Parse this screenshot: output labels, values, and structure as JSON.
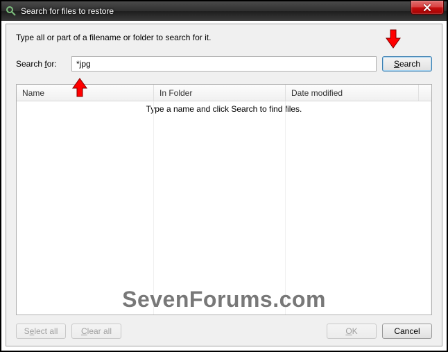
{
  "window": {
    "title": "Search for files to restore"
  },
  "instruction": "Type all or part of a filename or folder to search for it.",
  "search": {
    "label_pre": "Search ",
    "label_u": "f",
    "label_post": "or:",
    "value": "*jpg",
    "button_u": "S",
    "button_post": "earch"
  },
  "columns": {
    "name": "Name",
    "folder": "In Folder",
    "date": "Date modified"
  },
  "results": {
    "empty_message": "Type a name and click Search to find files."
  },
  "buttons": {
    "select_all_pre": "S",
    "select_all_u": "e",
    "select_all_post": "lect all",
    "clear_all_u": "C",
    "clear_all_post": "lear all",
    "ok_u": "O",
    "ok_post": "K",
    "cancel": "Cancel"
  },
  "watermark": "SevenForums.com"
}
